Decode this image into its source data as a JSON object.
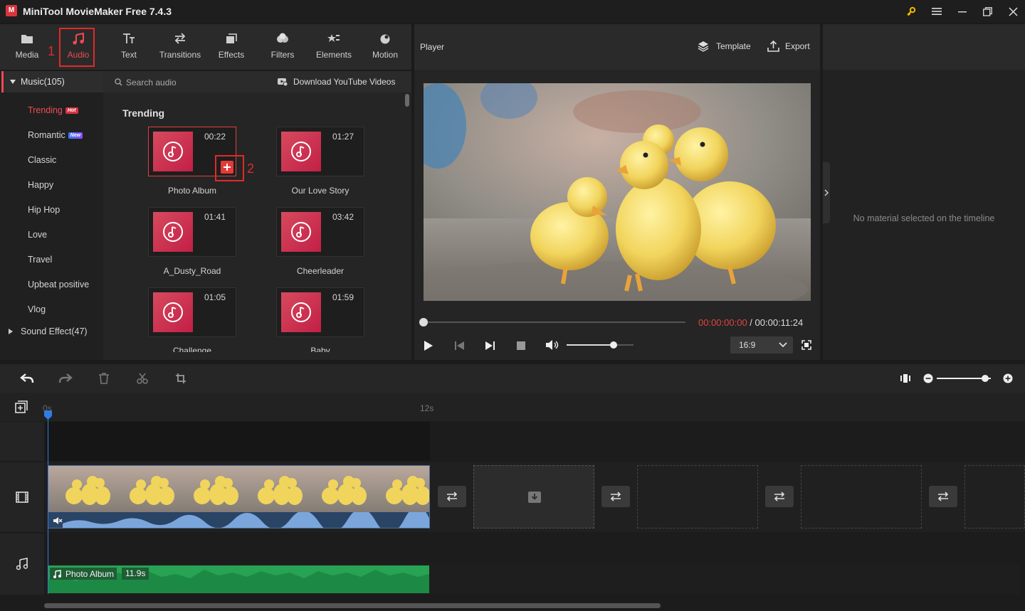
{
  "window": {
    "title": "MiniTool MovieMaker Free 7.4.3",
    "logo": "M"
  },
  "toolbar": {
    "items": [
      {
        "label": "Media",
        "icon": "folder-icon"
      },
      {
        "label": "Audio",
        "icon": "music-note-icon"
      },
      {
        "label": "Text",
        "icon": "text-icon"
      },
      {
        "label": "Transitions",
        "icon": "transitions-icon"
      },
      {
        "label": "Effects",
        "icon": "effects-icon"
      },
      {
        "label": "Filters",
        "icon": "filters-icon"
      },
      {
        "label": "Elements",
        "icon": "elements-icon"
      },
      {
        "label": "Motion",
        "icon": "motion-icon"
      }
    ],
    "step1": "1",
    "step2": "2"
  },
  "categories": {
    "music": "Music(105)",
    "items": [
      "Trending",
      "Romantic",
      "Classic",
      "Happy",
      "Hip Hop",
      "Love",
      "Travel",
      "Upbeat positive",
      "Vlog"
    ],
    "hot_badge": "Hot",
    "new_badge": "New",
    "sound_effect": "Sound Effect(47)"
  },
  "library": {
    "search_placeholder": "Search audio",
    "download": "Download YouTube Videos",
    "section": "Trending",
    "tracks": [
      {
        "name": "Photo Album",
        "duration": "00:22"
      },
      {
        "name": "Our Love Story",
        "duration": "01:27"
      },
      {
        "name": "A_Dusty_Road",
        "duration": "01:41"
      },
      {
        "name": "Cheerleader",
        "duration": "03:42"
      },
      {
        "name": "Challenge",
        "duration": "01:05"
      },
      {
        "name": "Baby",
        "duration": "01:59"
      }
    ]
  },
  "player": {
    "title": "Player",
    "template": "Template",
    "export": "Export",
    "current_time": "00:00:00:00",
    "separator": " / ",
    "total_time": "00:00:11:24",
    "aspect": "16:9",
    "progress": 0,
    "volume": 0.7
  },
  "properties": {
    "empty": "No material selected on the timeline"
  },
  "timeline": {
    "ruler_start": "0s",
    "ruler_mid": "12s",
    "audio_clip_name": "Photo Album",
    "audio_clip_duration": "11.9s",
    "zoom": 0.9
  },
  "colors": {
    "accent": "#ef4a54",
    "highlight": "#e12a2a",
    "audio_clip": "#27a353",
    "playhead": "#2f7de1"
  }
}
